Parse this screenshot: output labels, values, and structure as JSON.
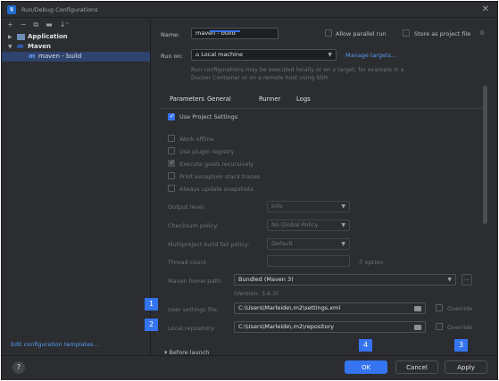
{
  "window": {
    "title": "Run/Debug Configurations",
    "logo": "IJ"
  },
  "toolbar": {
    "add": "+",
    "remove": "−",
    "copy": "⧉",
    "folder": "▬",
    "sort": "↓⁼"
  },
  "tree": {
    "items": [
      {
        "label": "Application"
      },
      {
        "label": "Maven"
      },
      {
        "label": "maven - build"
      }
    ]
  },
  "edit_templates_label": "Edit configuration templates...",
  "form": {
    "name_label": "Name:",
    "name_value": "maven - build",
    "allow_parallel_label": "Allow parallel run",
    "store_project_label": "Store as project file",
    "run_on_label": "Run on:",
    "run_on_value": "Local machine",
    "manage_targets_label": "Manage targets...",
    "run_on_hint": "Run configurations may be executed locally or on a target: for example in a Docker Container or on a remote host using SSH.",
    "tabs": [
      "Parameters",
      "General",
      "Runner",
      "Logs"
    ],
    "use_project_settings": "Use Project Settings",
    "options": [
      "Work offline",
      "Use plugin registry",
      "Execute goals recursively",
      "Print exception stack traces",
      "Always update snapshots"
    ],
    "output_level_label": "Output level:",
    "output_level_value": "Info",
    "checksum_label": "Checksum policy:",
    "checksum_value": "No Global Policy",
    "multiproject_label": "Multiproject build fail policy:",
    "multiproject_value": "Default",
    "thread_count_label": "Thread count",
    "thread_count_suffix": "-T option",
    "maven_home_label": "Maven home path:",
    "maven_home_value": "Bundled (Maven 3)",
    "maven_version": "(Version: 3.6.3)",
    "user_settings_label": "User settings file:",
    "user_settings_value": "C:\\Users\\Marleide\\.m2\\settings.xml",
    "local_repo_label": "Local repository:",
    "local_repo_value": "C:\\Users\\Marleide\\.m2\\repository",
    "override_label": "Override",
    "before_launch_label": "Before launch"
  },
  "markers": [
    "1",
    "2",
    "3",
    "4"
  ],
  "buttons": {
    "help": "?",
    "ok": "OK",
    "cancel": "Cancel",
    "apply": "Apply"
  },
  "colors": {
    "accent": "#3574f0",
    "background": "#2b2d30",
    "link": "#589df6"
  }
}
